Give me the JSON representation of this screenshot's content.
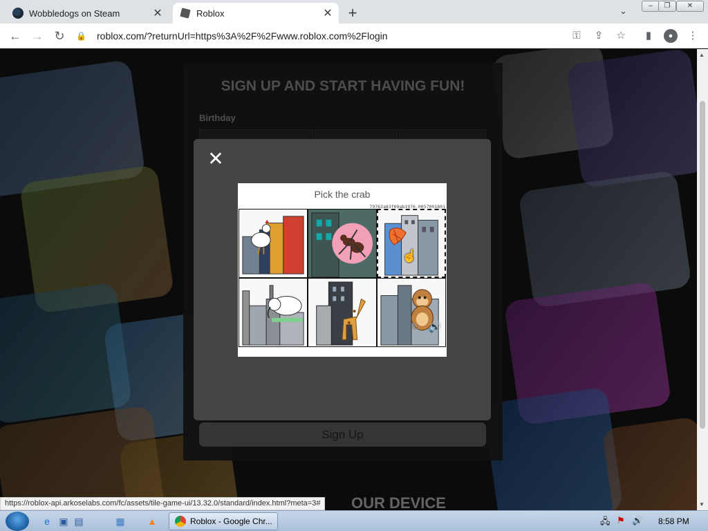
{
  "browser": {
    "tabs": [
      {
        "title": "Wobbledogs on Steam",
        "icon": "steam-icon",
        "active": false
      },
      {
        "title": "Roblox",
        "icon": "roblox-icon",
        "active": true
      }
    ],
    "new_tab_label": "+",
    "url": "roblox.com/?returnUrl=https%3A%2F%2Fwww.roblox.com%2Flogin"
  },
  "page": {
    "signup_title": "SIGN UP AND START HAVING FUN!",
    "birthday_label": "Birthday",
    "signup_button": "Sign Up",
    "device_text": "OUR DEVICE"
  },
  "captcha": {
    "prompt": "Pick the crab",
    "meta_id": "79762a83f09ab1976.0057001801",
    "tiles": [
      {
        "subject": "rooster",
        "selected": false
      },
      {
        "subject": "ant",
        "selected": false
      },
      {
        "subject": "crab",
        "selected": true
      },
      {
        "subject": "elephant",
        "selected": false
      },
      {
        "subject": "giraffe",
        "selected": false
      },
      {
        "subject": "monkey",
        "selected": false
      }
    ]
  },
  "status_url": "https://roblox-api.arkoselabs.com/fc/assets/tile-game-ui/13.32.0/standard/index.html?meta=3#",
  "taskbar": {
    "active_window": "Roblox - Google Chr...",
    "clock": "8:58 PM"
  },
  "colors": {
    "modal_bg": "#444444",
    "tab_bar": "#dee1e6",
    "taskbar": "#b8cbe2"
  }
}
